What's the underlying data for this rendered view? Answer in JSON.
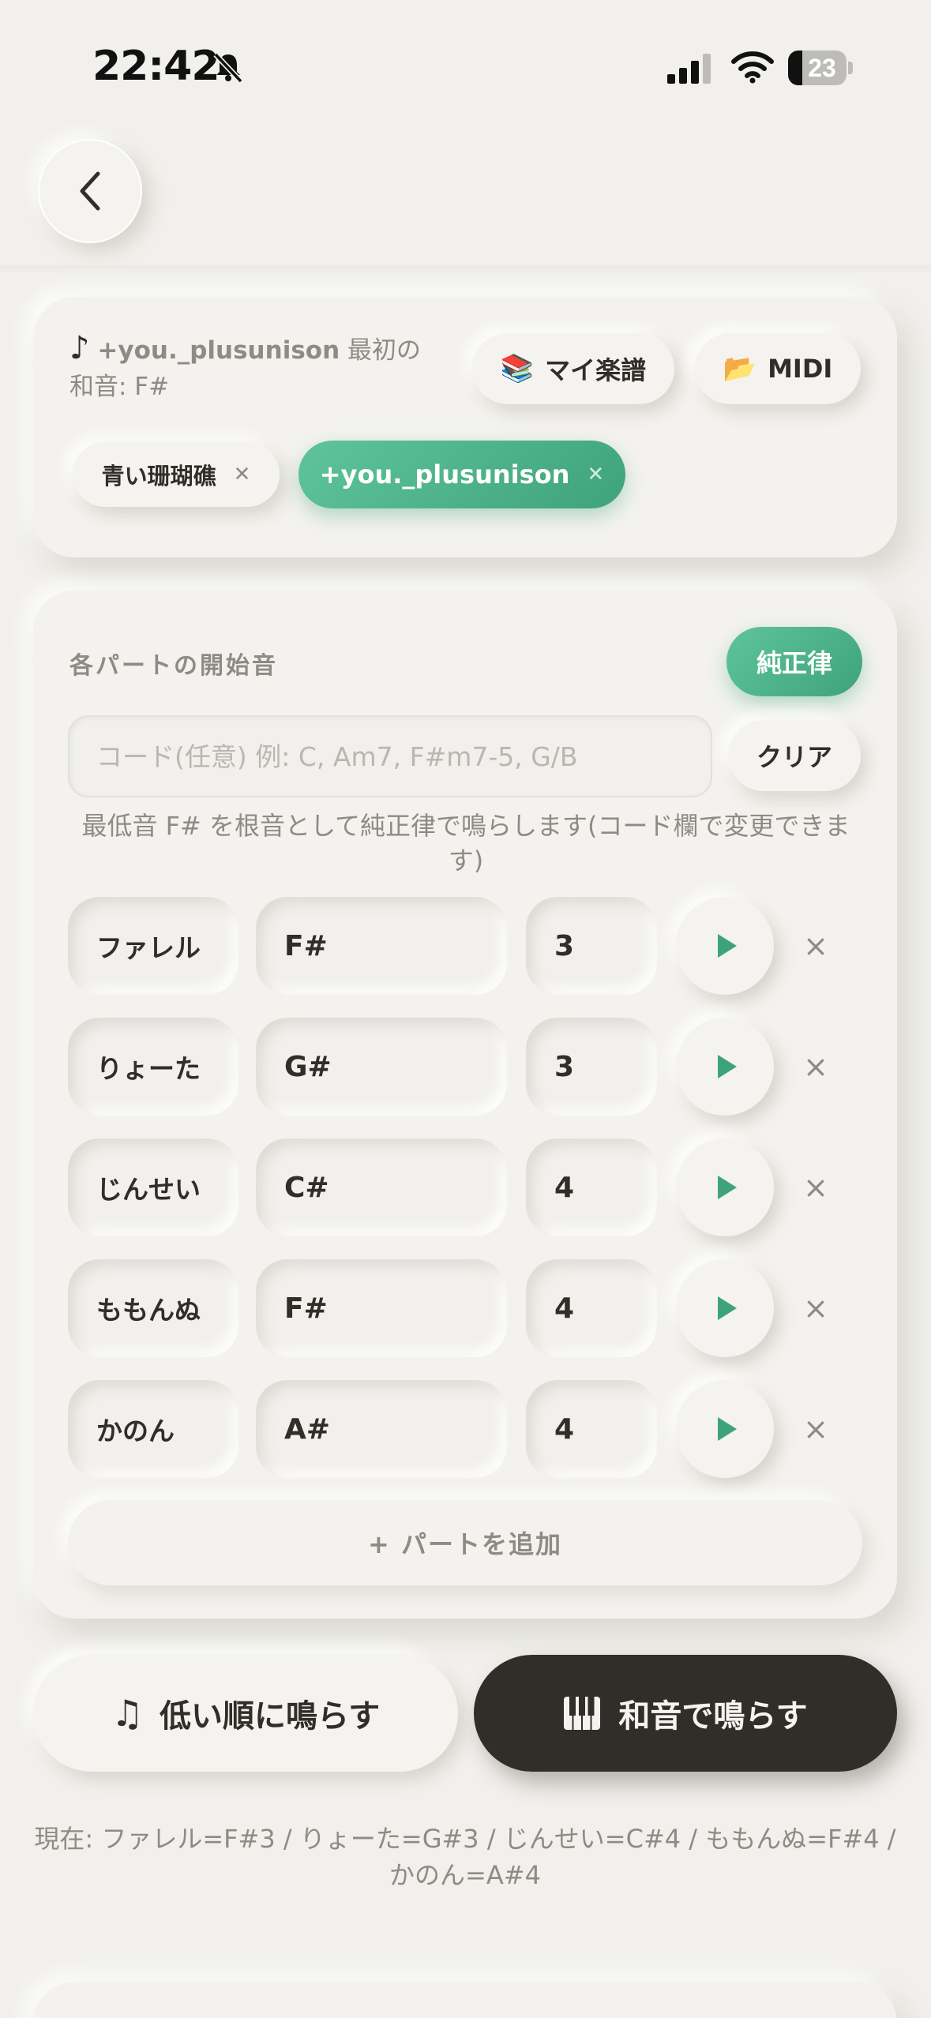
{
  "status_bar": {
    "time": "22:42",
    "battery": "23"
  },
  "header": {
    "back_icon": "chevron-left-icon"
  },
  "score_card": {
    "icon": "♪",
    "song": "+you._plusunison",
    "first_chord_text": " 最初の和音: F#",
    "my_scores_label": "マイ楽譜",
    "midi_label": "MIDI",
    "tags": [
      {
        "label": "青い珊瑚礁",
        "active": false
      },
      {
        "label": "+you._plusunison",
        "active": true
      }
    ]
  },
  "parts_card": {
    "section_label": "各パートの開始音",
    "tuning_label": "純正律",
    "chord_placeholder": "コード(任意) 例: C, Am7, F#m7-5, G/B",
    "clear_label": "クリア",
    "hint": "最低音 F# を根音として純正律で鳴らします(コード欄で変更できます)",
    "rows": [
      {
        "name": "ファレル",
        "note": "F#",
        "octave": "3"
      },
      {
        "name": "りょーた",
        "note": "G#",
        "octave": "3"
      },
      {
        "name": "じんせい",
        "note": "C#",
        "octave": "4"
      },
      {
        "name": "ももんぬ",
        "note": "F#",
        "octave": "4"
      },
      {
        "name": "かのん",
        "note": "A#",
        "octave": "4"
      }
    ],
    "remove_glyph": "×",
    "add_part_label": "+ パートを追加"
  },
  "actions": {
    "low_order_label": "低い順に鳴らす",
    "chord_label": "和音で鳴らす"
  },
  "current_text": "現在: ファレル=F#3 / りょーた=G#3 / じんせい=C#4 / ももんぬ=F#4 / かのん=A#4",
  "colors": {
    "accent": "#3ea37b",
    "dark": "#2f2e29",
    "background": "#f1f0ec"
  }
}
